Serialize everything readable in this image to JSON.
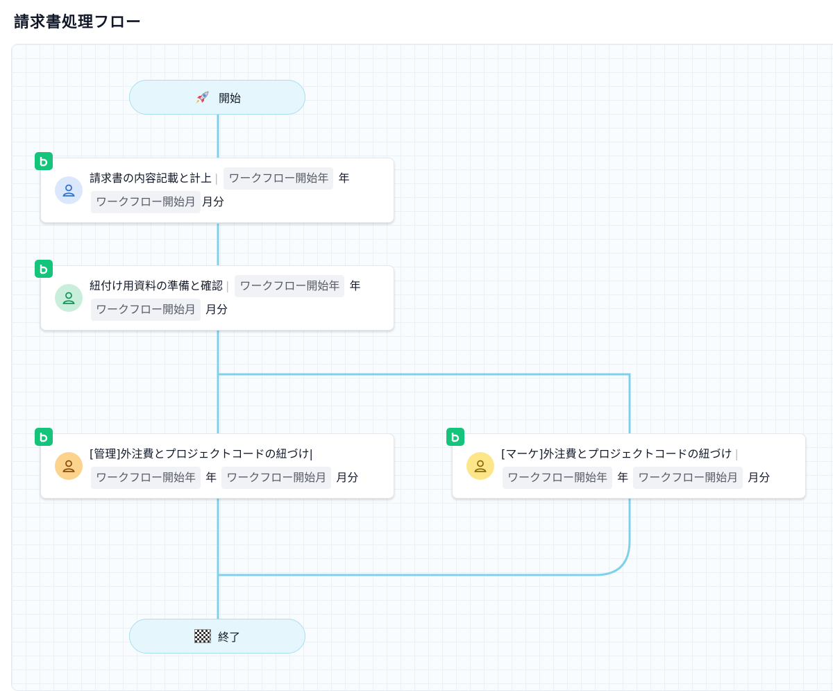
{
  "page": {
    "title": "請求書処理フロー"
  },
  "colors": {
    "connector": "#7fd1ea",
    "badge": "#14c47a",
    "avatar_blue": "#dbe8fb",
    "avatar_green": "#c9efdc",
    "avatar_orange": "#fbd38d",
    "avatar_yellow": "#fde68a"
  },
  "start": {
    "icon": "rocket-icon",
    "label": "開始"
  },
  "end": {
    "icon": "checkered-flag-icon",
    "label": "終了"
  },
  "nodes": [
    {
      "icon": "user-icon",
      "title": "請求書の内容記載と計上",
      "separator": "|",
      "var_year": "ワークフロー開始年",
      "year_unit": "年",
      "var_month": "ワークフロー開始月",
      "month_unit": "月分"
    },
    {
      "icon": "user-icon",
      "title": "紐付け用資料の準備と確認",
      "separator": "|",
      "var_year": "ワークフロー開始年",
      "year_unit": "年",
      "var_month": "ワークフロー開始月",
      "month_unit": "月分"
    },
    {
      "icon": "user-icon",
      "title": "[管理]外注費とプロジェクトコードの紐づけ|",
      "var_year": "ワークフロー開始年",
      "year_unit": "年",
      "var_month": "ワークフロー開始月",
      "month_unit": "月分"
    },
    {
      "icon": "user-icon",
      "title": "[マーケ]外注費とプロジェクトコードの紐づけ",
      "separator": "|",
      "var_year": "ワークフロー開始年",
      "year_unit": "年",
      "var_month": "ワークフロー開始月",
      "month_unit": "月分"
    }
  ]
}
